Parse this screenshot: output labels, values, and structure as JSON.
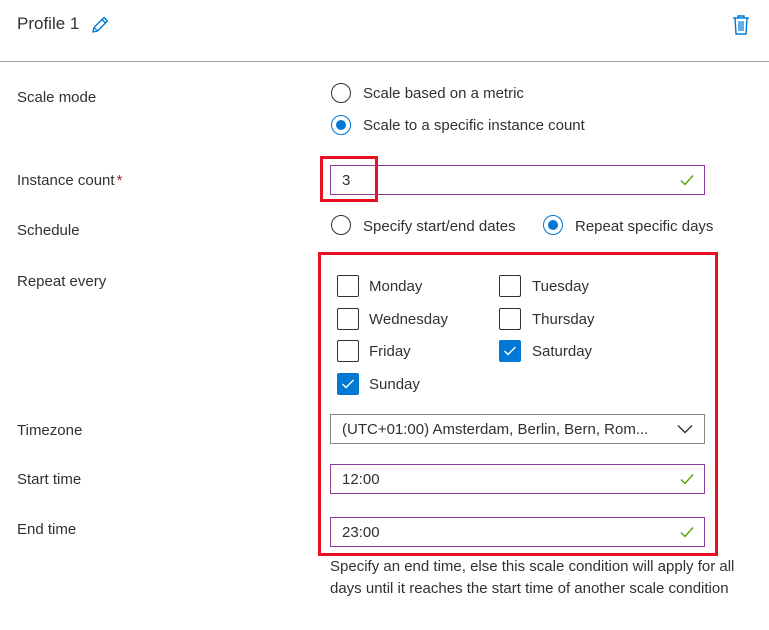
{
  "profile": {
    "title": "Profile 1",
    "edit_icon": "pencil-icon",
    "delete_icon": "trash-icon"
  },
  "scale_mode": {
    "label": "Scale mode",
    "options": [
      "Scale based on a metric",
      "Scale to a specific instance count"
    ],
    "selected": "Scale to a specific instance count"
  },
  "instance_count": {
    "label": "Instance count",
    "required_mark": "*",
    "value": "3"
  },
  "schedule": {
    "label": "Schedule",
    "options": [
      "Specify start/end dates",
      "Repeat specific days"
    ],
    "selected": "Repeat specific days"
  },
  "repeat_every": {
    "label": "Repeat every",
    "days": [
      {
        "name": "Monday",
        "checked": false
      },
      {
        "name": "Tuesday",
        "checked": false
      },
      {
        "name": "Wednesday",
        "checked": false
      },
      {
        "name": "Thursday",
        "checked": false
      },
      {
        "name": "Friday",
        "checked": false
      },
      {
        "name": "Saturday",
        "checked": true
      },
      {
        "name": "Sunday",
        "checked": true
      }
    ]
  },
  "timezone": {
    "label": "Timezone",
    "value": "(UTC+01:00) Amsterdam, Berlin, Bern, Rom..."
  },
  "start_time": {
    "label": "Start time",
    "value": "12:00"
  },
  "end_time": {
    "label": "End time",
    "value": "23:00",
    "help": "Specify an end time, else this scale condition will apply for all days until it reaches the start time of another scale condition"
  },
  "colors": {
    "accent": "#0078d4",
    "valid": "#57a300",
    "highlight": "#e81123",
    "field_border": "#8a3f9c"
  }
}
